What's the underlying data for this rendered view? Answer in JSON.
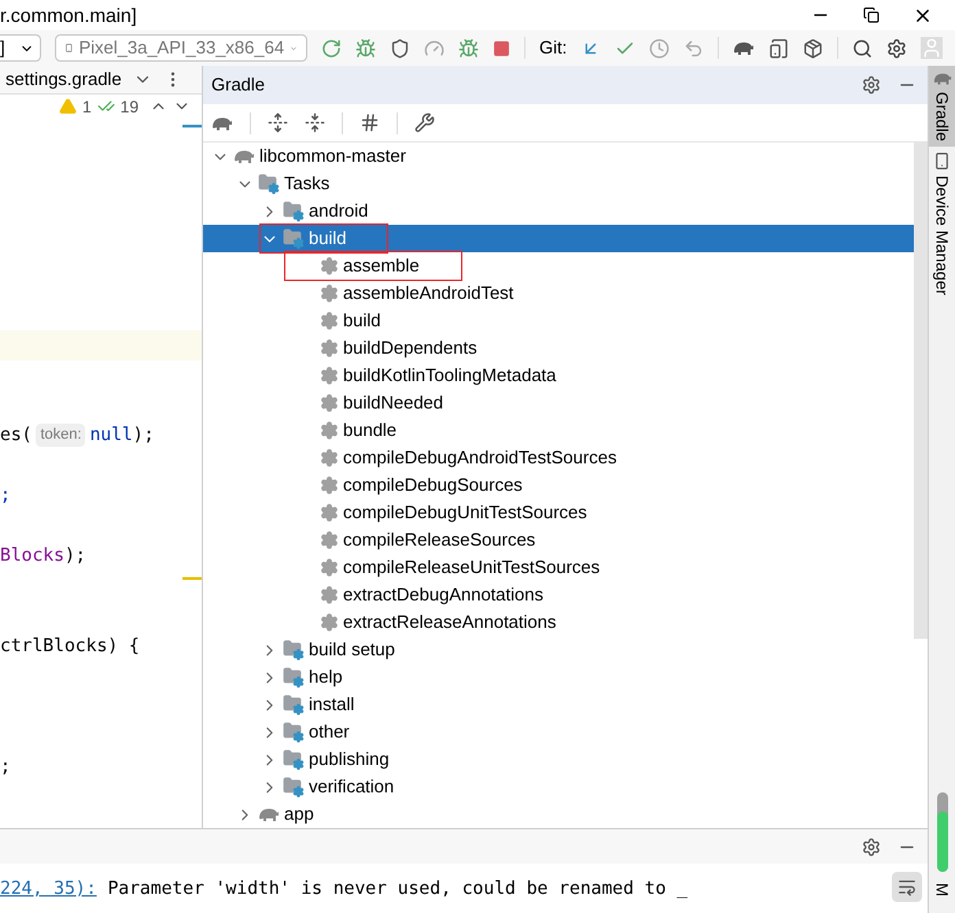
{
  "window": {
    "title": "r.common.main]"
  },
  "toolbar": {
    "config_dropdown": "]",
    "device": "Pixel_3a_API_33_x86_64",
    "git_label": "Git:"
  },
  "editor": {
    "tab": "settings.gradle",
    "warnings": "1",
    "checks": "19",
    "stripe_marks": [
      {
        "color": "#3592c4"
      },
      {
        "color": "#e6c000"
      }
    ],
    "lines": [
      {
        "segments": [
          {
            "kind": "plain",
            "text": "es("
          },
          {
            "kind": "hint",
            "text": "token:"
          },
          {
            "kind": "keyword",
            "text": "null"
          },
          {
            "kind": "plain",
            "text": ");"
          }
        ]
      },
      {
        "segments": [
          {
            "kind": "keyword",
            "text": ";"
          }
        ]
      },
      {
        "segments": [
          {
            "kind": "field",
            "text": "Blocks"
          },
          {
            "kind": "plain",
            "text": ");"
          }
        ]
      },
      {
        "segments": [
          {
            "kind": "plain",
            "text": "ctrlBlocks) {"
          }
        ]
      },
      {
        "segments": [
          {
            "kind": "plain",
            "text": ";"
          }
        ]
      }
    ]
  },
  "gradle": {
    "title": "Gradle",
    "tree": [
      {
        "label": "libcommon-master",
        "kind": "project",
        "expanded": true,
        "selected": false,
        "outlined": false,
        "children": [
          {
            "label": "Tasks",
            "kind": "folder",
            "expanded": true,
            "selected": false,
            "outlined": false,
            "children": [
              {
                "label": "android",
                "kind": "folder",
                "expanded": false,
                "selected": false,
                "outlined": false
              },
              {
                "label": "build",
                "kind": "folder",
                "expanded": true,
                "selected": true,
                "outlined": true,
                "children": [
                  {
                    "label": "assemble",
                    "kind": "task",
                    "selected": false,
                    "outlined": true
                  },
                  {
                    "label": "assembleAndroidTest",
                    "kind": "task",
                    "selected": false,
                    "outlined": false
                  },
                  {
                    "label": "build",
                    "kind": "task",
                    "selected": false,
                    "outlined": false
                  },
                  {
                    "label": "buildDependents",
                    "kind": "task",
                    "selected": false,
                    "outlined": false
                  },
                  {
                    "label": "buildKotlinToolingMetadata",
                    "kind": "task",
                    "selected": false,
                    "outlined": false
                  },
                  {
                    "label": "buildNeeded",
                    "kind": "task",
                    "selected": false,
                    "outlined": false
                  },
                  {
                    "label": "bundle",
                    "kind": "task",
                    "selected": false,
                    "outlined": false
                  },
                  {
                    "label": "compileDebugAndroidTestSources",
                    "kind": "task",
                    "selected": false,
                    "outlined": false
                  },
                  {
                    "label": "compileDebugSources",
                    "kind": "task",
                    "selected": false,
                    "outlined": false
                  },
                  {
                    "label": "compileDebugUnitTestSources",
                    "kind": "task",
                    "selected": false,
                    "outlined": false
                  },
                  {
                    "label": "compileReleaseSources",
                    "kind": "task",
                    "selected": false,
                    "outlined": false
                  },
                  {
                    "label": "compileReleaseUnitTestSources",
                    "kind": "task",
                    "selected": false,
                    "outlined": false
                  },
                  {
                    "label": "extractDebugAnnotations",
                    "kind": "task",
                    "selected": false,
                    "outlined": false
                  },
                  {
                    "label": "extractReleaseAnnotations",
                    "kind": "task",
                    "selected": false,
                    "outlined": false
                  }
                ]
              },
              {
                "label": "build setup",
                "kind": "folder",
                "expanded": false,
                "selected": false,
                "outlined": false
              },
              {
                "label": "help",
                "kind": "folder",
                "expanded": false,
                "selected": false,
                "outlined": false
              },
              {
                "label": "install",
                "kind": "folder",
                "expanded": false,
                "selected": false,
                "outlined": false
              },
              {
                "label": "other",
                "kind": "folder",
                "expanded": false,
                "selected": false,
                "outlined": false
              },
              {
                "label": "publishing",
                "kind": "folder",
                "expanded": false,
                "selected": false,
                "outlined": false
              },
              {
                "label": "verification",
                "kind": "folder",
                "expanded": false,
                "selected": false,
                "outlined": false
              }
            ]
          },
          {
            "label": "app",
            "kind": "project",
            "expanded": false,
            "selected": false,
            "outlined": false
          }
        ]
      }
    ]
  },
  "side_tabs": [
    {
      "label": "Gradle",
      "kind": "gradle",
      "selected": true
    },
    {
      "label": "Device Manager",
      "kind": "device",
      "selected": false
    }
  ],
  "side_bottom": "M",
  "console": {
    "link": "224, 35):",
    "message": "Parameter 'width' is never used, could be renamed to _"
  }
}
